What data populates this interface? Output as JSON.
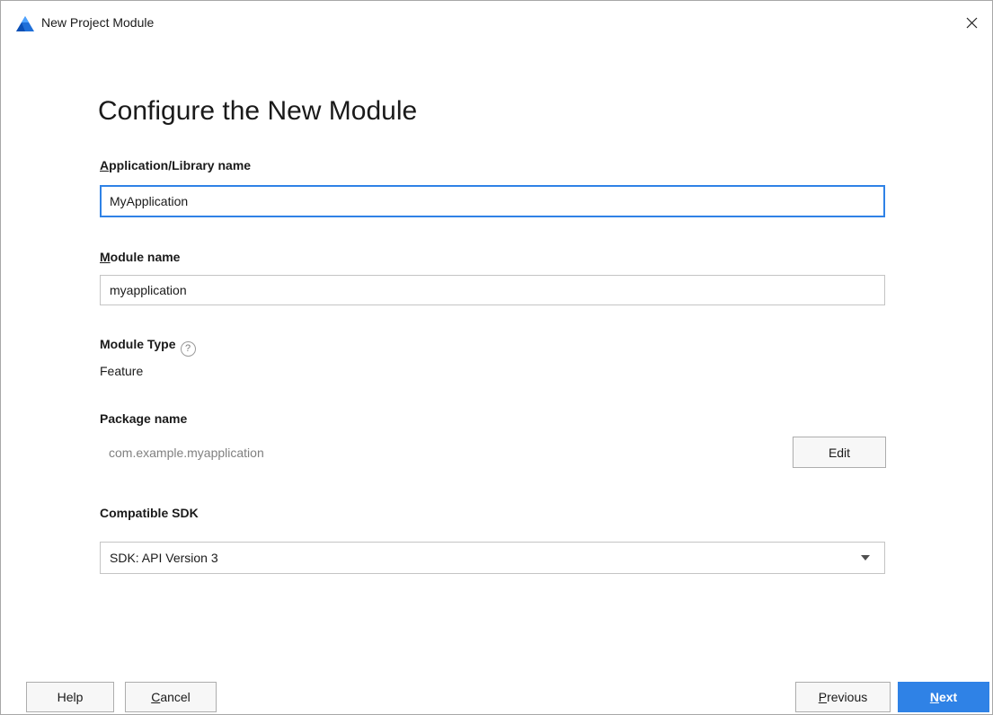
{
  "window": {
    "title": "New Project Module",
    "close_glyph": "✕",
    "accent_color": "#2f82e6"
  },
  "page": {
    "heading": "Configure the New Module"
  },
  "app_name": {
    "label_mnemonic": "A",
    "label_rest": "pplication/Library name",
    "value": "MyApplication"
  },
  "module_name": {
    "label_mnemonic": "M",
    "label_rest": "odule name",
    "value": "myapplication"
  },
  "module_type": {
    "label": "Module Type",
    "help_glyph": "?",
    "value": "Feature"
  },
  "package_name": {
    "label": "Package name",
    "value": "com.example.myapplication",
    "edit_label": "Edit"
  },
  "compatible_sdk": {
    "label": "Compatible SDK",
    "selected": "SDK: API Version 3"
  },
  "footer": {
    "help_label": "Help",
    "cancel_mnemonic": "C",
    "cancel_rest": "ancel",
    "previous_mnemonic": "P",
    "previous_rest": "revious",
    "next_mnemonic": "N",
    "next_rest": "ext"
  },
  "icons": {
    "app": "devstudio-logo-icon",
    "close": "close-icon",
    "help": "help-circle-icon",
    "dropdown": "chevron-down-icon"
  }
}
